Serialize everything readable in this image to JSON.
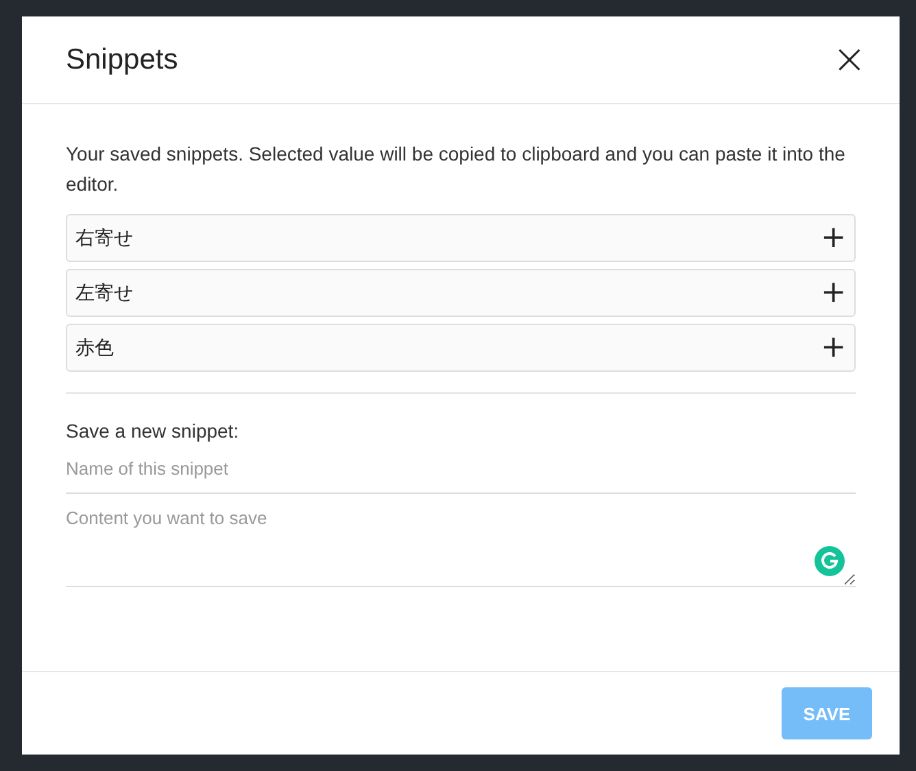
{
  "dialog": {
    "title": "Snippets",
    "close_label": "×"
  },
  "description": "Your saved snippets. Selected value will be copied to clipboard and you can paste it into the editor.",
  "snippets": [
    {
      "name": "右寄せ",
      "action": "+"
    },
    {
      "name": "左寄せ",
      "action": "+"
    },
    {
      "name": "赤色",
      "action": "+"
    }
  ],
  "new_snippet": {
    "heading": "Save a new snippet:",
    "name_field": {
      "placeholder": "Name of this snippet"
    },
    "content_field": {
      "placeholder": "Content you want to save"
    }
  },
  "save_button": {
    "label": "SAVE",
    "disabled": true
  }
}
